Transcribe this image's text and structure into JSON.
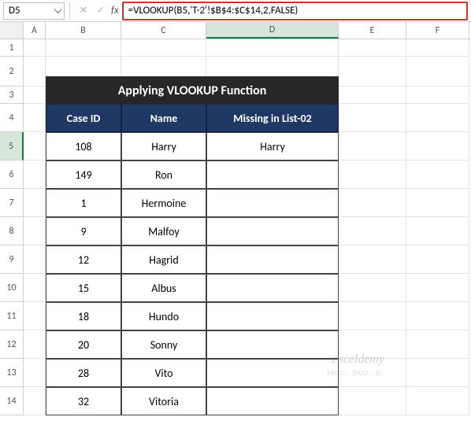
{
  "name_box": "D5",
  "formula": "=VLOOKUP(B5,'T-2'!$B$4:$C$14,2,FALSE)",
  "fx": "fx",
  "columns": [
    "A",
    "B",
    "C",
    "D",
    "E",
    "F"
  ],
  "row_labels": [
    "1",
    "2",
    "3",
    "4",
    "5",
    "6",
    "7",
    "8",
    "9",
    "10",
    "11",
    "12",
    "13",
    "14"
  ],
  "title": "Applying VLOOKUP Function",
  "headers": {
    "b": "Case ID",
    "c": "Name",
    "d": "Missing in List-02"
  },
  "data": [
    {
      "id": "108",
      "name": "Harry",
      "missing": "Harry"
    },
    {
      "id": "149",
      "name": "Ron",
      "missing": ""
    },
    {
      "id": "1",
      "name": "Hermoine",
      "missing": ""
    },
    {
      "id": "9",
      "name": "Malfoy",
      "missing": ""
    },
    {
      "id": "12",
      "name": "Hagrid",
      "missing": ""
    },
    {
      "id": "15",
      "name": "Albus",
      "missing": ""
    },
    {
      "id": "18",
      "name": "Hundo",
      "missing": ""
    },
    {
      "id": "20",
      "name": "Sonny",
      "missing": ""
    },
    {
      "id": "28",
      "name": "Vito",
      "missing": ""
    },
    {
      "id": "32",
      "name": "Vitoria",
      "missing": ""
    }
  ],
  "watermark": "exceldemy",
  "watermark_sub": "EXCEL · DATA · BI"
}
